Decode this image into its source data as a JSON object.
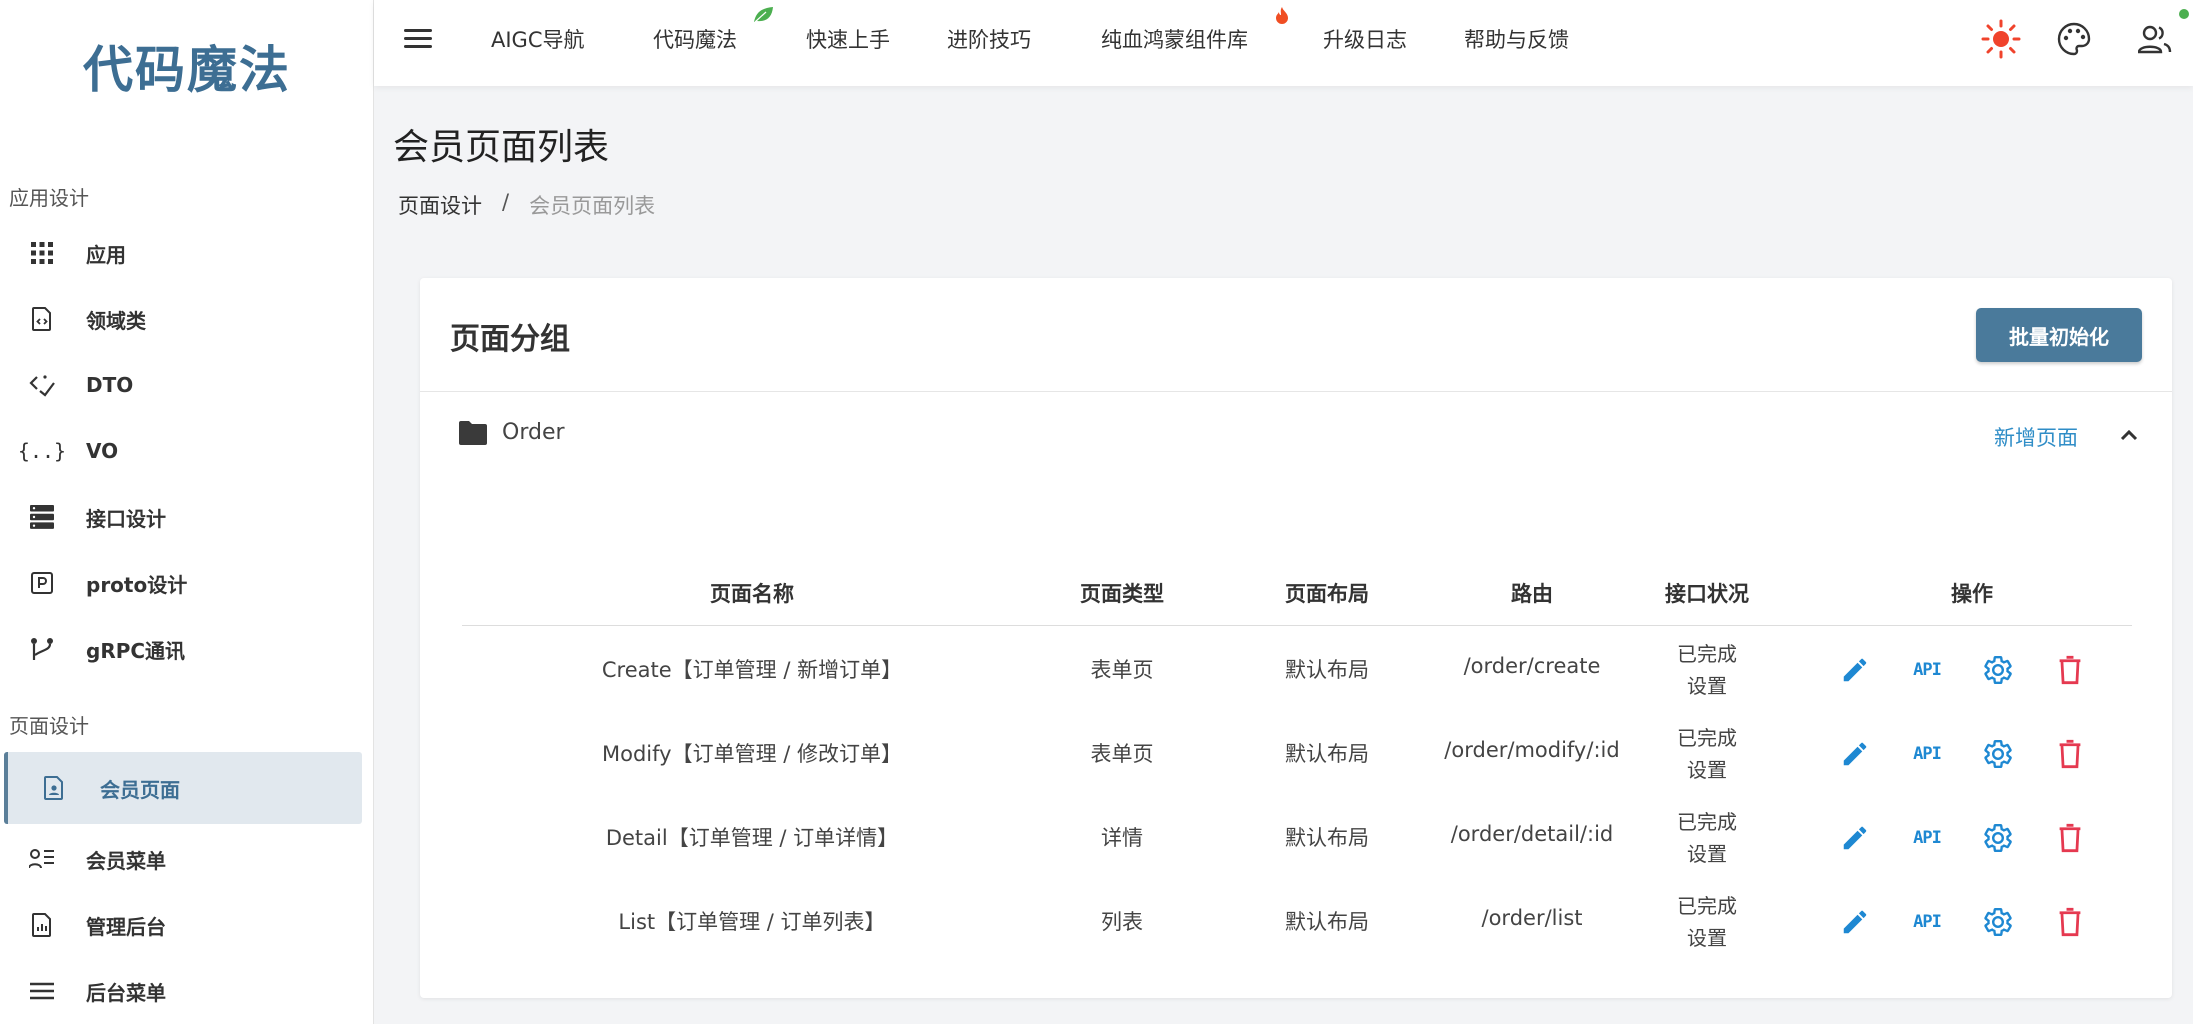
{
  "app": {
    "logo": "代码魔法"
  },
  "colors": {
    "brand": "#3d6e93",
    "primary": "#4a7a9b",
    "link": "#2f8dc7",
    "danger": "#e53950",
    "icon_blue": "#1e88d2"
  },
  "sidebar": {
    "sections": [
      {
        "title": "应用设计"
      },
      {
        "title": "页面设计"
      }
    ],
    "items": [
      {
        "label": "应用",
        "icon": "grid-icon"
      },
      {
        "label": "领域类",
        "icon": "code-file-icon"
      },
      {
        "label": "DTO",
        "icon": "code-arrows-icon"
      },
      {
        "label": "VO",
        "icon": "braces-icon"
      },
      {
        "label": "接口设计",
        "icon": "server-icon"
      },
      {
        "label": "proto设计",
        "icon": "p-box-icon"
      },
      {
        "label": "gRPC通讯",
        "icon": "branch-icon"
      },
      {
        "label": "会员页面",
        "icon": "member-file-icon",
        "active": true
      },
      {
        "label": "会员菜单",
        "icon": "member-list-icon"
      },
      {
        "label": "管理后台",
        "icon": "chart-file-icon"
      },
      {
        "label": "后台菜单",
        "icon": "menu-lines-icon"
      }
    ]
  },
  "topbar": {
    "links": [
      "AIGC导航",
      "代码魔法",
      "快速上手",
      "进阶技巧",
      "纯血鸿蒙组件库",
      "升级日志",
      "帮助与反馈"
    ],
    "icons": [
      "sun-icon",
      "palette-icon",
      "users-icon"
    ]
  },
  "page": {
    "title": "会员页面列表",
    "breadcrumb": [
      "页面设计",
      "/",
      "会员页面列表"
    ]
  },
  "card": {
    "title": "页面分组",
    "batch_button": "批量初始化",
    "group": {
      "name": "Order",
      "add_label": "新增页面"
    },
    "table": {
      "headers": [
        "页面名称",
        "页面类型",
        "页面布局",
        "路由",
        "接口状况",
        "操作"
      ],
      "rows": [
        {
          "name": "Create【订单管理 / 新增订单】",
          "type": "表单页",
          "layout": "默认布局",
          "route": "/order/create",
          "status1": "已完成",
          "status2": "设置"
        },
        {
          "name": "Modify【订单管理 / 修改订单】",
          "type": "表单页",
          "layout": "默认布局",
          "route": "/order/modify/:id",
          "status1": "已完成",
          "status2": "设置"
        },
        {
          "name": "Detail【订单管理 / 订单详情】",
          "type": "详情",
          "layout": "默认布局",
          "route": "/order/detail/:id",
          "status1": "已完成",
          "status2": "设置"
        },
        {
          "name": "List【订单管理 / 订单列表】",
          "type": "列表",
          "layout": "默认布局",
          "route": "/order/list",
          "status1": "已完成",
          "status2": "设置"
        }
      ],
      "api_label": "API"
    }
  }
}
